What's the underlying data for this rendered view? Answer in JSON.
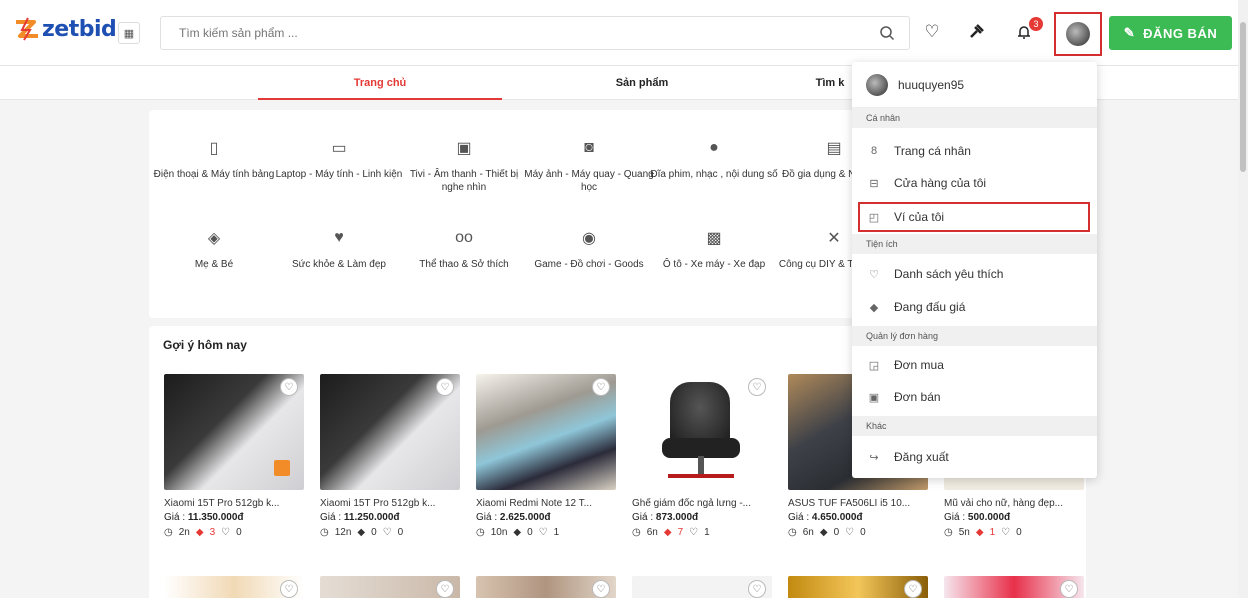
{
  "header": {
    "logo_text": "zetbid",
    "search_placeholder": "Tìm kiếm sản phẩm ...",
    "notification_count": "3",
    "sell_label": "ĐĂNG BÁN"
  },
  "tabs": [
    {
      "label": "Trang chủ",
      "active": true
    },
    {
      "label": "Sản phẩm",
      "active": false
    },
    {
      "label": "Tìm k",
      "active": false
    }
  ],
  "categories": [
    {
      "label": "Điện thoại & Máy tính bảng",
      "icon": "phone-icon"
    },
    {
      "label": "Laptop - Máy tính - Linh kiện",
      "icon": "laptop-icon"
    },
    {
      "label": "Tivi - Âm thanh - Thiết bị nghe nhìn",
      "icon": "tv-icon"
    },
    {
      "label": "Máy ảnh - Máy quay - Quang học",
      "icon": "camera-icon"
    },
    {
      "label": "Đĩa phim, nhạc , nội dung số",
      "icon": "disc-icon"
    },
    {
      "label": "Đồ gia dụng & Nhà bếp",
      "icon": "fridge-icon"
    },
    {
      "label": "Mẹ & Bé",
      "icon": "baby-icon"
    },
    {
      "label": "Sức khỏe & Làm đẹp",
      "icon": "heart-pulse-icon"
    },
    {
      "label": "Thể thao & Sở thích",
      "icon": "bicycle-icon"
    },
    {
      "label": "Game - Đồ chơi - Goods",
      "icon": "gamepad-icon"
    },
    {
      "label": "Ô tô - Xe máy - Xe đạp",
      "icon": "car-icon"
    },
    {
      "label": "Công cụ DIY & Thủ công",
      "icon": "tools-icon"
    }
  ],
  "suggestions": {
    "title": "Gợi ý hôm nay",
    "price_prefix": "Giá : ",
    "products": [
      {
        "name": "Xiaomi 15T Pro 512gb k...",
        "price": "11.350.000đ",
        "time": "2n",
        "bids": "3",
        "likes": "0",
        "bid_active": true
      },
      {
        "name": "Xiaomi 15T Pro 512gb k...",
        "price": "11.250.000đ",
        "time": "12n",
        "bids": "0",
        "likes": "0",
        "bid_active": false
      },
      {
        "name": "Xiaomi Redmi Note 12 T...",
        "price": "2.625.000đ",
        "time": "10n",
        "bids": "0",
        "likes": "1",
        "bid_active": false
      },
      {
        "name": "Ghế giám đốc ngả lưng -...",
        "price": "873.000đ",
        "time": "6n",
        "bids": "7",
        "likes": "1",
        "bid_active": true
      },
      {
        "name": "ASUS TUF FA506LI i5 10...",
        "price": "4.650.000đ",
        "time": "6n",
        "bids": "0",
        "likes": "0",
        "bid_active": false
      },
      {
        "name": "Mũ vải cho nữ, hàng đẹp...",
        "price": "500.000đ",
        "time": "5n",
        "bids": "1",
        "likes": "0",
        "bid_active": true
      }
    ]
  },
  "dropdown": {
    "username": "huuquyen95",
    "sections": [
      {
        "label": "Cá nhân"
      },
      {
        "label": "Tiện ích"
      },
      {
        "label": "Quản lý đơn hàng"
      },
      {
        "label": "Khác"
      }
    ],
    "items": [
      {
        "label": "Trang cá nhân",
        "icon": "user-icon"
      },
      {
        "label": "Cửa hàng của tôi",
        "icon": "store-icon"
      },
      {
        "label": "Ví của tôi",
        "icon": "wallet-icon"
      },
      {
        "label": "Danh sách yêu thích",
        "icon": "heart-icon"
      },
      {
        "label": "Đang đấu giá",
        "icon": "gavel-icon"
      },
      {
        "label": "Đơn mua",
        "icon": "bag-icon"
      },
      {
        "label": "Đơn bán",
        "icon": "receipt-icon"
      },
      {
        "label": "Đăng xuất",
        "icon": "logout-icon"
      }
    ]
  },
  "colors": {
    "accent_red": "#e53935",
    "brand_blue": "#1e4fb3",
    "sell_green": "#3cba54"
  }
}
